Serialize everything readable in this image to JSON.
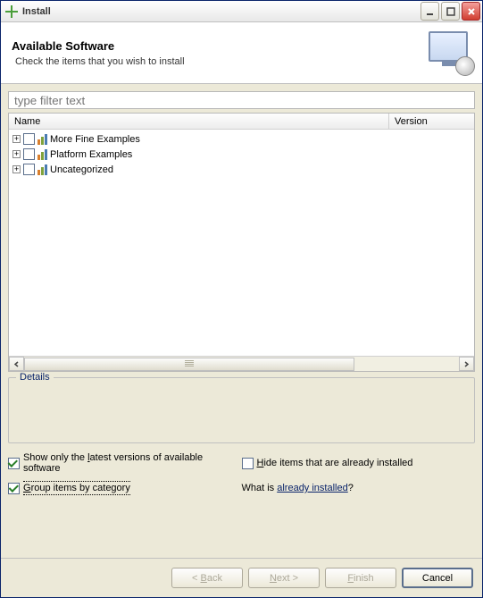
{
  "window": {
    "title": "Install"
  },
  "banner": {
    "title": "Available Software",
    "subtitle": "Check the items that you wish to install"
  },
  "filter": {
    "placeholder": "type filter text"
  },
  "columns": {
    "name": "Name",
    "version": "Version"
  },
  "tree": {
    "items": [
      {
        "label": "More Fine Examples"
      },
      {
        "label": "Platform Examples"
      },
      {
        "label": "Uncategorized"
      }
    ]
  },
  "details": {
    "legend": "Details"
  },
  "options": {
    "showLatest": {
      "prefix": "Show only the ",
      "mn": "l",
      "suffix": "atest versions of available software",
      "checked": true
    },
    "hideInstalled": {
      "mn": "H",
      "suffix": "ide items that are already installed",
      "checked": false
    },
    "groupCategory": {
      "mn": "G",
      "suffix": "roup items by category",
      "checked": true
    },
    "whatIs": {
      "prefix": "What is ",
      "link": "already installed",
      "suffix": "?"
    }
  },
  "buttons": {
    "back": "< Back",
    "next": "Next >",
    "finish": "Finish",
    "cancel": "Cancel"
  }
}
